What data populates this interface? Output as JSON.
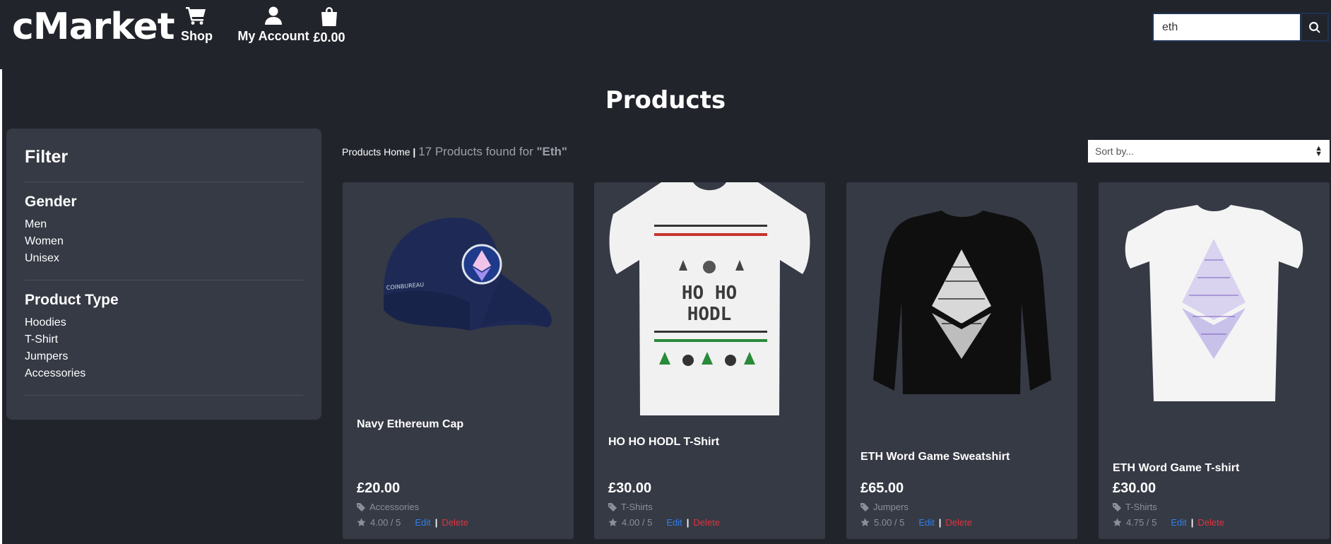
{
  "header": {
    "logo": "cMarket",
    "nav": {
      "shop": "Shop",
      "account": "My Account",
      "cart": "£0.00"
    },
    "search": {
      "value": "eth",
      "icon": "search-icon"
    }
  },
  "page_title": "Products",
  "filter": {
    "title": "Filter",
    "sections": [
      {
        "title": "Gender",
        "items": [
          "Men",
          "Women",
          "Unisex"
        ]
      },
      {
        "title": "Product Type",
        "items": [
          "Hoodies",
          "T-Shirt",
          "Jumpers",
          "Accessories"
        ]
      }
    ]
  },
  "toolbar": {
    "home": "Products Home",
    "separator": "|",
    "found_prefix": "17 Products found for",
    "query": "\"Eth\"",
    "sort_placeholder": "Sort by..."
  },
  "products": [
    {
      "name": "Navy Ethereum Cap",
      "price": "£20.00",
      "category": "Accessories",
      "rating": "4.00 / 5",
      "edit": "Edit",
      "sep": "|",
      "delete": "Delete"
    },
    {
      "name": "HO HO HODL T-Shirt",
      "price": "£30.00",
      "category": "T-Shirts",
      "rating": "4.00 / 5",
      "edit": "Edit",
      "sep": "|",
      "delete": "Delete"
    },
    {
      "name": "ETH Word Game Sweatshirt",
      "price": "£65.00",
      "category": "Jumpers",
      "rating": "5.00 / 5",
      "edit": "Edit",
      "sep": "|",
      "delete": "Delete"
    },
    {
      "name": "ETH Word Game T-shirt",
      "price": "£30.00",
      "category": "T-Shirts",
      "rating": "4.75 / 5",
      "edit": "Edit",
      "sep": "|",
      "delete": "Delete"
    }
  ],
  "colors": {
    "background": "#22242b",
    "panel": "#363a45",
    "edit": "#2f7fe6",
    "delete": "#e0333e"
  }
}
